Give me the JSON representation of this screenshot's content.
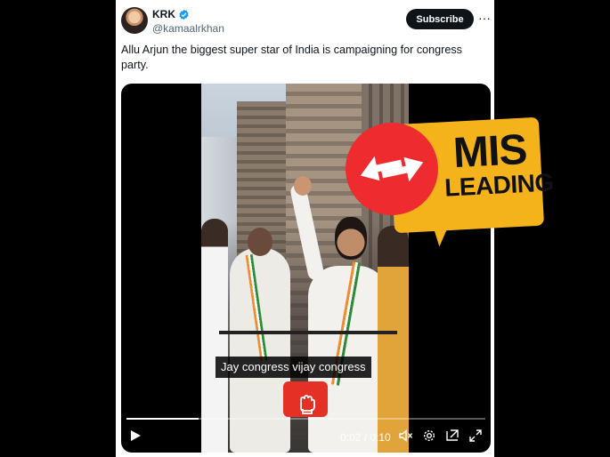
{
  "author": {
    "name": "KRK",
    "handle": "@kamaalrkhan",
    "verified": true
  },
  "subscribe_label": "Subscribe",
  "more_label": "···",
  "tweet_text": "Allu Arjun the biggest super star of India is campaigning for congress party.",
  "video": {
    "caption": "Jay congress vijay congress",
    "time": "0:02 / 0:10",
    "progress_fraction": 0.2
  },
  "badge": {
    "line1": "MIS",
    "line2": "LEADING",
    "colors": {
      "circle": "#ee2b2e",
      "speech": "#f4b31b"
    }
  },
  "icons": [
    "verified-icon",
    "more-options-icon",
    "play-icon",
    "volume-muted-icon",
    "settings-gear-icon",
    "pip-icon",
    "fullscreen-icon",
    "swap-arrows-icon",
    "raised-fist-icon"
  ],
  "colors": {
    "subscribe_bg": "#0f1419",
    "verified": "#1d9bf0",
    "handle": "#536471"
  }
}
